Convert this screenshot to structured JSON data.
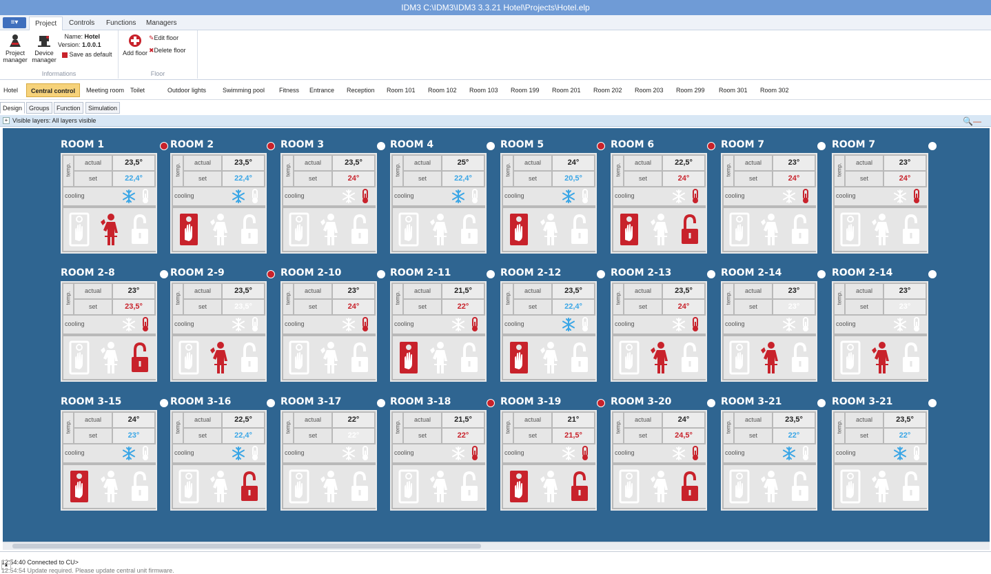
{
  "window": {
    "title": "IDM3 C:\\IDM3\\IDM3 3.3.21 Hotel\\Projects\\Hotel.elp"
  },
  "menu": {
    "app_button": "≡▾",
    "tabs": [
      "Project",
      "Controls",
      "Functions",
      "Managers"
    ]
  },
  "ribbon": {
    "project_manager": "Project manager",
    "device_manager": "Device manager",
    "name_label": "Name:",
    "name_value": "Hotel",
    "version_label": "Version:",
    "version_value": "1.0.0.1",
    "save_default": "Save as default",
    "informations_group": "Informations",
    "add_floor": "Add floor",
    "edit_floor": "Edit floor",
    "delete_floor": "Delete floor",
    "floor_group": "Floor"
  },
  "floor_tabs": [
    "Hotel",
    "Central control",
    "Meeting room",
    "Toilet",
    "Outdoor lights",
    "Swimming pool",
    "Fitness",
    "Entrance",
    "Reception",
    "Room 101",
    "Room 102",
    "Room 103",
    "Room 199",
    "Room 201",
    "Room 202",
    "Room 203",
    "Room 299",
    "Room 301",
    "Room 302"
  ],
  "active_floor_tab": "Central control",
  "view_tabs": [
    "Design",
    "Groups",
    "Function",
    "Simulation"
  ],
  "layer_bar": {
    "text": "Visible layers: All layers visible"
  },
  "labels": {
    "temp": "temp.",
    "actual": "actual",
    "set": "set",
    "cooling": "cooling"
  },
  "colors": {
    "canvas": "#2f6591",
    "alert_red": "#c8222b",
    "cool_blue": "#3aa6e6",
    "inactive": "#ffffff"
  },
  "rooms": [
    {
      "name": "ROOM 1",
      "dot": "red",
      "actual": "23,5°",
      "set": "22,4°",
      "set_color": "blue",
      "snow": true,
      "thermo": false,
      "door": false,
      "person": true,
      "lock": false
    },
    {
      "name": "ROOM 2",
      "dot": "red",
      "actual": "23,5°",
      "set": "22,4°",
      "set_color": "blue",
      "snow": true,
      "thermo": false,
      "door": true,
      "person": false,
      "lock": false
    },
    {
      "name": "ROOM 3",
      "dot": "white",
      "actual": "23,5°",
      "set": "24°",
      "set_color": "red",
      "snow": false,
      "thermo": true,
      "door": false,
      "person": false,
      "lock": false
    },
    {
      "name": "ROOM 4",
      "dot": "white",
      "actual": "25°",
      "set": "22,4°",
      "set_color": "blue",
      "snow": true,
      "thermo": false,
      "door": false,
      "person": false,
      "lock": false
    },
    {
      "name": "ROOM 5",
      "dot": "red",
      "actual": "24°",
      "set": "20,5°",
      "set_color": "blue",
      "snow": true,
      "thermo": false,
      "door": true,
      "person": false,
      "lock": false
    },
    {
      "name": "ROOM 6",
      "dot": "red",
      "actual": "22,5°",
      "set": "24°",
      "set_color": "red",
      "snow": false,
      "thermo": true,
      "door": true,
      "person": false,
      "lock": true
    },
    {
      "name": "ROOM 7",
      "dot": "white",
      "actual": "23°",
      "set": "24°",
      "set_color": "red",
      "snow": false,
      "thermo": true,
      "door": false,
      "person": false,
      "lock": false
    },
    {
      "name": "ROOM 7",
      "dot": "white",
      "actual": "23°",
      "set": "24°",
      "set_color": "red",
      "snow": false,
      "thermo": true,
      "door": false,
      "person": false,
      "lock": false
    },
    {
      "name": "ROOM 2-8",
      "dot": "white",
      "actual": "23°",
      "set": "23,5°",
      "set_color": "red",
      "snow": false,
      "thermo": true,
      "door": false,
      "person": false,
      "lock": true
    },
    {
      "name": "ROOM 2-9",
      "dot": "red",
      "actual": "23,5°",
      "set": "23,5°",
      "set_color": "white",
      "snow": false,
      "thermo": false,
      "door": false,
      "person": true,
      "lock": false
    },
    {
      "name": "ROOM 2-10",
      "dot": "white",
      "actual": "23°",
      "set": "24°",
      "set_color": "red",
      "snow": false,
      "thermo": true,
      "door": false,
      "person": false,
      "lock": false
    },
    {
      "name": "ROOM 2-11",
      "dot": "white",
      "actual": "21,5°",
      "set": "22°",
      "set_color": "red",
      "snow": false,
      "thermo": true,
      "door": true,
      "person": false,
      "lock": false
    },
    {
      "name": "ROOM 2-12",
      "dot": "white",
      "actual": "23,5°",
      "set": "22,4°",
      "set_color": "blue",
      "snow": true,
      "thermo": false,
      "door": true,
      "person": false,
      "lock": false
    },
    {
      "name": "ROOM 2-13",
      "dot": "white",
      "actual": "23,5°",
      "set": "24°",
      "set_color": "red",
      "snow": false,
      "thermo": true,
      "door": false,
      "person": true,
      "lock": false
    },
    {
      "name": "ROOM 2-14",
      "dot": "white",
      "actual": "23°",
      "set": "23°",
      "set_color": "white",
      "snow": false,
      "thermo": false,
      "door": false,
      "person": true,
      "lock": false
    },
    {
      "name": "ROOM 2-14",
      "dot": "white",
      "actual": "23°",
      "set": "23°",
      "set_color": "white",
      "snow": false,
      "thermo": false,
      "door": false,
      "person": true,
      "lock": false
    },
    {
      "name": "ROOM 3-15",
      "dot": "white",
      "actual": "24°",
      "set": "23°",
      "set_color": "blue",
      "snow": true,
      "thermo": false,
      "door": true,
      "person": false,
      "lock": false
    },
    {
      "name": "ROOM 3-16",
      "dot": "white",
      "actual": "22,5°",
      "set": "22,4°",
      "set_color": "blue",
      "snow": true,
      "thermo": false,
      "door": false,
      "person": false,
      "lock": true
    },
    {
      "name": "ROOM 3-17",
      "dot": "white",
      "actual": "22°",
      "set": "22°",
      "set_color": "white",
      "snow": false,
      "thermo": false,
      "door": false,
      "person": false,
      "lock": false
    },
    {
      "name": "ROOM 3-18",
      "dot": "red",
      "actual": "21,5°",
      "set": "22°",
      "set_color": "red",
      "snow": false,
      "thermo": true,
      "door": false,
      "person": false,
      "lock": false
    },
    {
      "name": "ROOM 3-19",
      "dot": "red",
      "actual": "21°",
      "set": "21,5°",
      "set_color": "red",
      "snow": false,
      "thermo": true,
      "door": true,
      "person": false,
      "lock": true
    },
    {
      "name": "ROOM 3-20",
      "dot": "white",
      "actual": "24°",
      "set": "24,5°",
      "set_color": "red",
      "snow": false,
      "thermo": true,
      "door": false,
      "person": false,
      "lock": true
    },
    {
      "name": "ROOM 3-21",
      "dot": "white",
      "actual": "23,5°",
      "set": "22°",
      "set_color": "blue",
      "snow": true,
      "thermo": false,
      "door": false,
      "person": false,
      "lock": false
    },
    {
      "name": "ROOM 3-21",
      "dot": "white",
      "actual": "23,5°",
      "set": "22°",
      "set_color": "blue",
      "snow": true,
      "thermo": false,
      "door": false,
      "person": false,
      "lock": false
    }
  ],
  "log": {
    "line1": "12:54:40 Connected to CU>",
    "line2": "12:54:54 Update required. Please update central unit firmware."
  }
}
